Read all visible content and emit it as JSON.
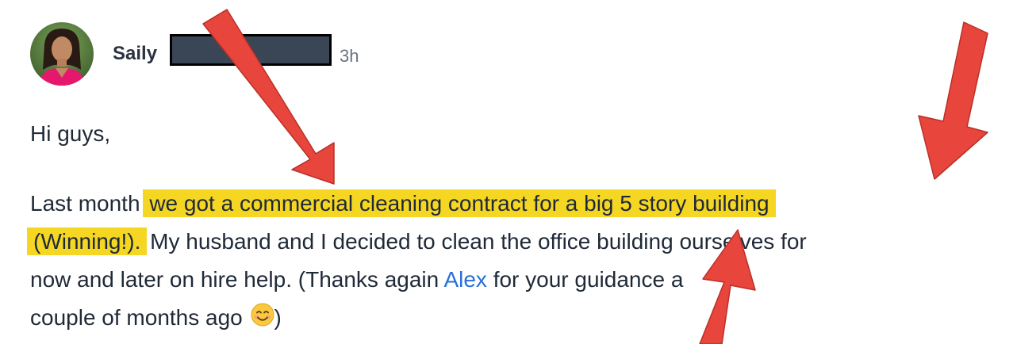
{
  "post": {
    "author": "Saily",
    "timestamp": "3h",
    "greeting": "Hi guys,",
    "line1_pre": "Last month ",
    "line1_highlight": "we got a commercial cleaning contract for a big 5 story building",
    "line2_highlight": "(Winning!).",
    "line2_rest": " My husband and I decided to clean the office building ourselves for",
    "line3_pre": "now and later on hire help. (Thanks again ",
    "mention": "Alex",
    "line3_post": " for your guidance a",
    "line4_text": "couple of months ago ",
    "line4_close": ")"
  },
  "colors": {
    "highlight": "#f5d623",
    "mention": "#2a6fdb",
    "arrow": "#e8453c",
    "redaction": "#3a4556"
  },
  "icons": {
    "emoji": "smiling-face-emoji"
  }
}
